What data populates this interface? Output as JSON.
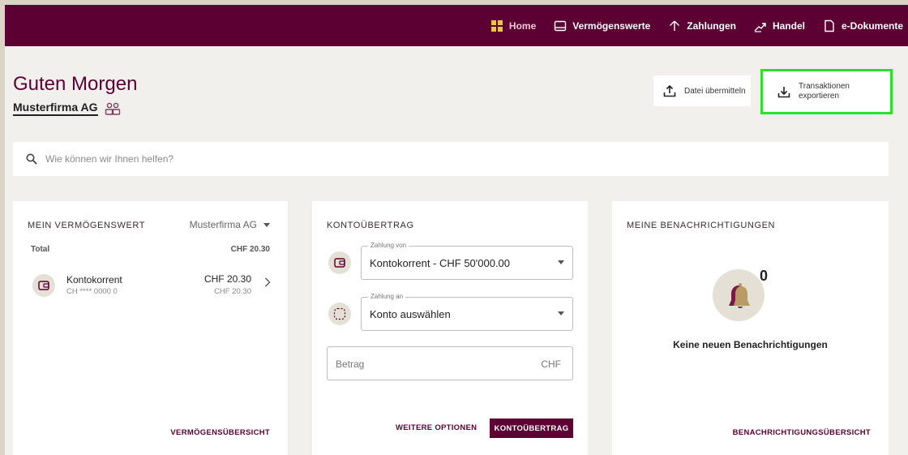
{
  "nav": {
    "home": "Home",
    "assets": "Vermögenswerte",
    "payments": "Zahlungen",
    "trading": "Handel",
    "edocs": "e-Dokumente"
  },
  "header": {
    "greeting": "Guten Morgen",
    "company": "Musterfirma AG",
    "upload_label": "Datei übermitteln",
    "export_label": "Transaktionen exportieren"
  },
  "search": {
    "placeholder": "Wie können wir Ihnen helfen?"
  },
  "assets_card": {
    "title": "MEIN VERMÖGENSWERT",
    "selected_company": "Musterfirma AG",
    "total_label": "Total",
    "total_value": "CHF 20.30",
    "accounts": [
      {
        "name": "Kontokorrent",
        "iban": "CH **** 0000 0",
        "amount": "CHF 20.30",
        "amount_sub": "CHF 20.30"
      }
    ],
    "footer_link": "VERMÖGENSÜBERSICHT"
  },
  "transfer_card": {
    "title": "KONTOÜBERTRAG",
    "from_legend": "Zahlung von",
    "from_value": "Kontokorrent - CHF 50'000.00",
    "to_legend": "Zahlung an",
    "to_value": "Konto auswählen",
    "amount_placeholder": "Betrag",
    "amount_currency": "CHF",
    "more_options": "WEITERE OPTIONEN",
    "submit": "KONTOÜBERTRAG"
  },
  "notifications_card": {
    "title": "MEINE BENACHRICHTIGUNGEN",
    "count": "0",
    "empty_text": "Keine neuen Benachrichtigungen",
    "footer_link": "BENACHRICHTIGUNGSÜBERSICHT"
  },
  "colors": {
    "brand": "#5c0033",
    "highlight": "#2ee02e",
    "background": "#f2f0ec"
  }
}
